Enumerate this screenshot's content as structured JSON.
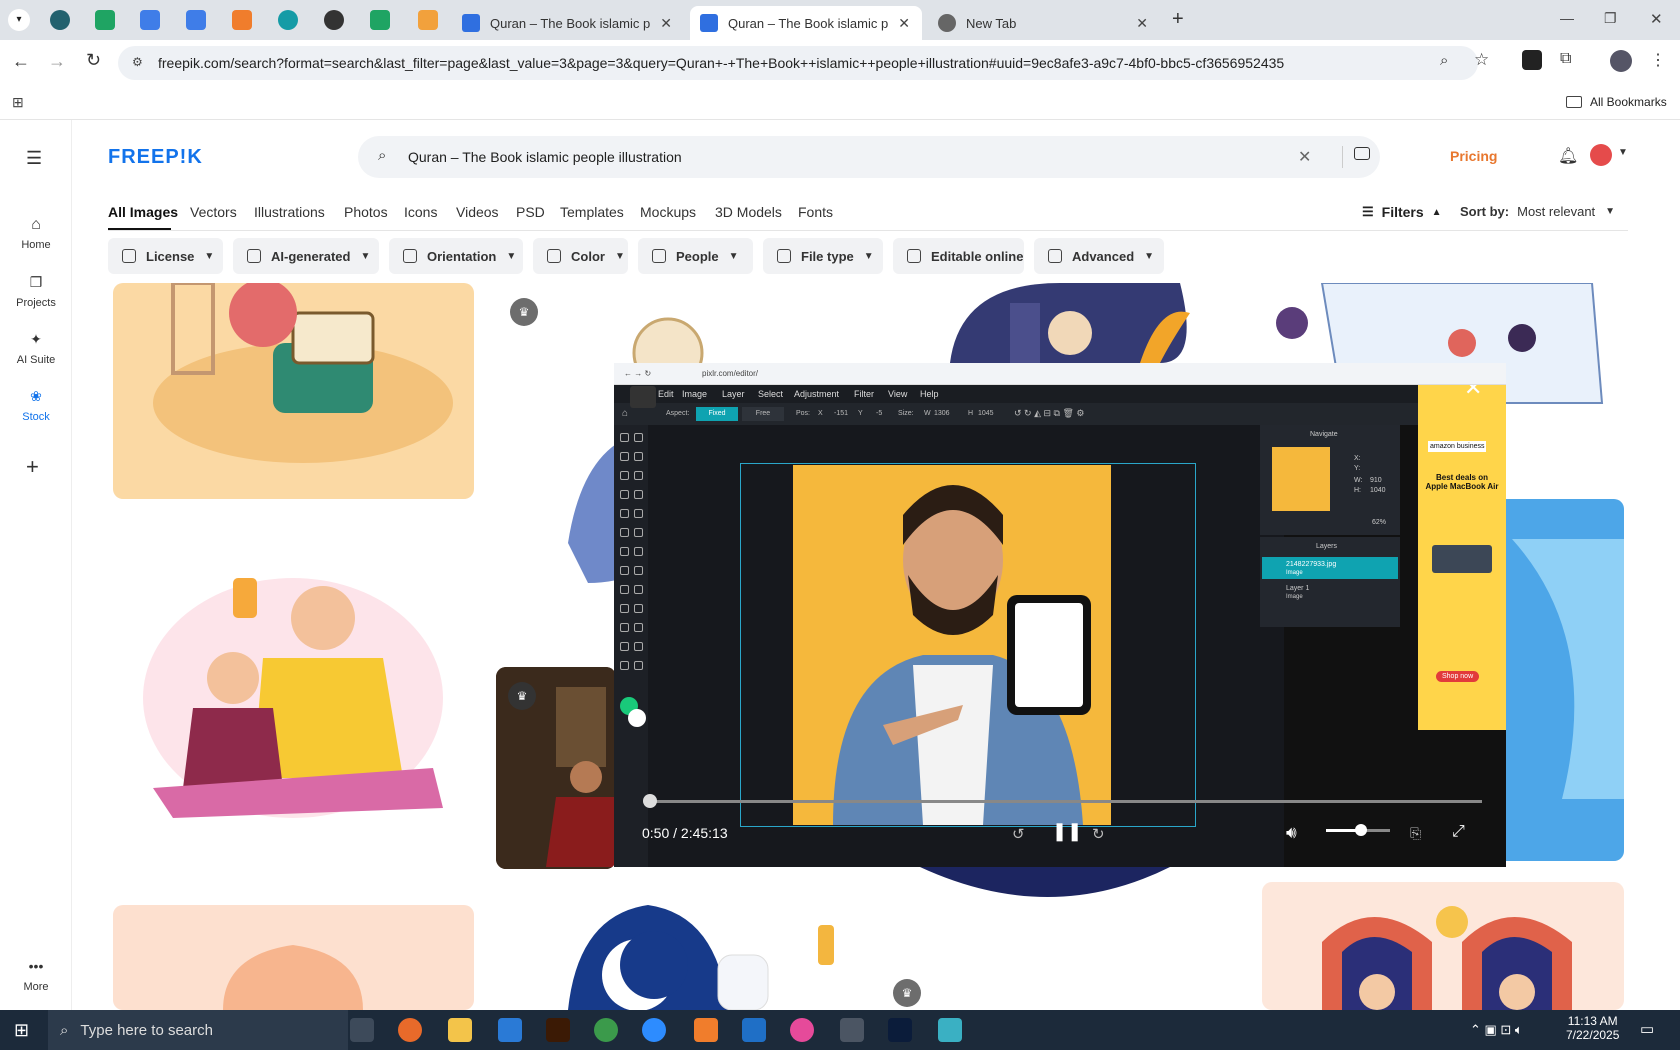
{
  "browser": {
    "tabs": [
      {
        "label": "Quran – The Book islamic peop",
        "active": false
      },
      {
        "label": "Quran – The Book islamic peop",
        "active": true
      },
      {
        "label": "New Tab",
        "active": false
      }
    ],
    "url": "freepik.com/search?format=search&last_filter=page&last_value=3&page=3&query=Quran+-+The+Book++islamic++people+illustration#uuid=9ec8afe3-a9c7-4bf0-bbc5-cf3656952435",
    "bookmarks_label": "All Bookmarks"
  },
  "sidebar": {
    "items": [
      {
        "label": "Home",
        "icon": "home-icon"
      },
      {
        "label": "Projects",
        "icon": "projects-icon"
      },
      {
        "label": "AI Suite",
        "icon": "ai-suite-icon"
      },
      {
        "label": "Stock",
        "icon": "stock-icon"
      }
    ],
    "more_label": "More"
  },
  "header": {
    "logo": "FREEP!K",
    "search_value": "Quran – The Book  islamic  people illustration",
    "pricing": "Pricing"
  },
  "tabs": [
    "All Images",
    "Vectors",
    "Illustrations",
    "Photos",
    "Icons",
    "Videos",
    "PSD",
    "Templates",
    "Mockups",
    "3D Models",
    "Fonts"
  ],
  "filters_label": "Filters",
  "sort": {
    "label": "Sort by:",
    "value": "Most relevant"
  },
  "filter_buttons": [
    "License",
    "AI-generated",
    "Orientation",
    "Color",
    "People",
    "File type",
    "Editable online",
    "Advanced"
  ],
  "video": {
    "inner_url": "pixlr.com/editor/",
    "menu": [
      "Edit",
      "Image",
      "Layer",
      "Select",
      "Adjustment",
      "Filter",
      "View",
      "Help"
    ],
    "toolbar": {
      "aspect_label": "Aspect:",
      "fixed": "Fixed",
      "free": "Free",
      "pos_label": "Pos:",
      "x_label": "X",
      "x_value": "-151",
      "y_label": "Y",
      "y_value": "-5",
      "size_label": "Size:",
      "w_label": "W",
      "w_value": "1306",
      "h_label": "H",
      "h_value": "1045"
    },
    "navigate_title": "Navigate",
    "nav_readout": {
      "x": "X:",
      "y": "Y:",
      "w": "W:",
      "w_val": "910",
      "h": "H:",
      "h_val": "1040"
    },
    "zoom": "62%",
    "layers_title": "Layers",
    "layers": [
      {
        "name": "2148227933.jpg",
        "type": "Image"
      },
      {
        "name": "Layer 1",
        "type": "Image"
      }
    ],
    "ad": {
      "brand": "amazon business",
      "headline": "Best deals on Apple MacBook Air",
      "button": "Shop now"
    },
    "time": "0:50 / 2:45:13",
    "progress": 0.005,
    "volume": 0.55
  },
  "taskbar": {
    "search_placeholder": "Type here to search",
    "time": "11:13 AM",
    "date": "7/22/2025"
  },
  "colors": {
    "brand": "#1273eb",
    "pricing": "#e8772e",
    "teal": "#0fa3b1"
  }
}
